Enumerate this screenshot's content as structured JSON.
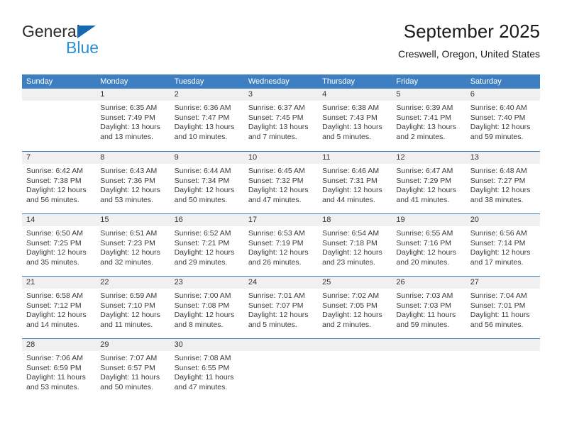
{
  "brand": {
    "line1": "General",
    "line2": "Blue",
    "triangle_color": "#1668b3",
    "line2_color": "#2a8fd4"
  },
  "header": {
    "title": "September 2025",
    "subtitle": "Creswell, Oregon, United States"
  },
  "colors": {
    "header_row": "#3d7fc1",
    "day_band": "#f0f0f0",
    "row_divider": "#3d7fc1",
    "text": "#3a3a3a"
  },
  "weekdays": [
    "Sunday",
    "Monday",
    "Tuesday",
    "Wednesday",
    "Thursday",
    "Friday",
    "Saturday"
  ],
  "weeks": [
    [
      {
        "day": "",
        "sunrise": "",
        "sunset": "",
        "daylight_a": "",
        "daylight_b": "",
        "empty": true
      },
      {
        "day": "1",
        "sunrise": "Sunrise: 6:35 AM",
        "sunset": "Sunset: 7:49 PM",
        "daylight_a": "Daylight: 13 hours",
        "daylight_b": "and 13 minutes."
      },
      {
        "day": "2",
        "sunrise": "Sunrise: 6:36 AM",
        "sunset": "Sunset: 7:47 PM",
        "daylight_a": "Daylight: 13 hours",
        "daylight_b": "and 10 minutes."
      },
      {
        "day": "3",
        "sunrise": "Sunrise: 6:37 AM",
        "sunset": "Sunset: 7:45 PM",
        "daylight_a": "Daylight: 13 hours",
        "daylight_b": "and 7 minutes."
      },
      {
        "day": "4",
        "sunrise": "Sunrise: 6:38 AM",
        "sunset": "Sunset: 7:43 PM",
        "daylight_a": "Daylight: 13 hours",
        "daylight_b": "and 5 minutes."
      },
      {
        "day": "5",
        "sunrise": "Sunrise: 6:39 AM",
        "sunset": "Sunset: 7:41 PM",
        "daylight_a": "Daylight: 13 hours",
        "daylight_b": "and 2 minutes."
      },
      {
        "day": "6",
        "sunrise": "Sunrise: 6:40 AM",
        "sunset": "Sunset: 7:40 PM",
        "daylight_a": "Daylight: 12 hours",
        "daylight_b": "and 59 minutes."
      }
    ],
    [
      {
        "day": "7",
        "sunrise": "Sunrise: 6:42 AM",
        "sunset": "Sunset: 7:38 PM",
        "daylight_a": "Daylight: 12 hours",
        "daylight_b": "and 56 minutes."
      },
      {
        "day": "8",
        "sunrise": "Sunrise: 6:43 AM",
        "sunset": "Sunset: 7:36 PM",
        "daylight_a": "Daylight: 12 hours",
        "daylight_b": "and 53 minutes."
      },
      {
        "day": "9",
        "sunrise": "Sunrise: 6:44 AM",
        "sunset": "Sunset: 7:34 PM",
        "daylight_a": "Daylight: 12 hours",
        "daylight_b": "and 50 minutes."
      },
      {
        "day": "10",
        "sunrise": "Sunrise: 6:45 AM",
        "sunset": "Sunset: 7:32 PM",
        "daylight_a": "Daylight: 12 hours",
        "daylight_b": "and 47 minutes."
      },
      {
        "day": "11",
        "sunrise": "Sunrise: 6:46 AM",
        "sunset": "Sunset: 7:31 PM",
        "daylight_a": "Daylight: 12 hours",
        "daylight_b": "and 44 minutes."
      },
      {
        "day": "12",
        "sunrise": "Sunrise: 6:47 AM",
        "sunset": "Sunset: 7:29 PM",
        "daylight_a": "Daylight: 12 hours",
        "daylight_b": "and 41 minutes."
      },
      {
        "day": "13",
        "sunrise": "Sunrise: 6:48 AM",
        "sunset": "Sunset: 7:27 PM",
        "daylight_a": "Daylight: 12 hours",
        "daylight_b": "and 38 minutes."
      }
    ],
    [
      {
        "day": "14",
        "sunrise": "Sunrise: 6:50 AM",
        "sunset": "Sunset: 7:25 PM",
        "daylight_a": "Daylight: 12 hours",
        "daylight_b": "and 35 minutes."
      },
      {
        "day": "15",
        "sunrise": "Sunrise: 6:51 AM",
        "sunset": "Sunset: 7:23 PM",
        "daylight_a": "Daylight: 12 hours",
        "daylight_b": "and 32 minutes."
      },
      {
        "day": "16",
        "sunrise": "Sunrise: 6:52 AM",
        "sunset": "Sunset: 7:21 PM",
        "daylight_a": "Daylight: 12 hours",
        "daylight_b": "and 29 minutes."
      },
      {
        "day": "17",
        "sunrise": "Sunrise: 6:53 AM",
        "sunset": "Sunset: 7:19 PM",
        "daylight_a": "Daylight: 12 hours",
        "daylight_b": "and 26 minutes."
      },
      {
        "day": "18",
        "sunrise": "Sunrise: 6:54 AM",
        "sunset": "Sunset: 7:18 PM",
        "daylight_a": "Daylight: 12 hours",
        "daylight_b": "and 23 minutes."
      },
      {
        "day": "19",
        "sunrise": "Sunrise: 6:55 AM",
        "sunset": "Sunset: 7:16 PM",
        "daylight_a": "Daylight: 12 hours",
        "daylight_b": "and 20 minutes."
      },
      {
        "day": "20",
        "sunrise": "Sunrise: 6:56 AM",
        "sunset": "Sunset: 7:14 PM",
        "daylight_a": "Daylight: 12 hours",
        "daylight_b": "and 17 minutes."
      }
    ],
    [
      {
        "day": "21",
        "sunrise": "Sunrise: 6:58 AM",
        "sunset": "Sunset: 7:12 PM",
        "daylight_a": "Daylight: 12 hours",
        "daylight_b": "and 14 minutes."
      },
      {
        "day": "22",
        "sunrise": "Sunrise: 6:59 AM",
        "sunset": "Sunset: 7:10 PM",
        "daylight_a": "Daylight: 12 hours",
        "daylight_b": "and 11 minutes."
      },
      {
        "day": "23",
        "sunrise": "Sunrise: 7:00 AM",
        "sunset": "Sunset: 7:08 PM",
        "daylight_a": "Daylight: 12 hours",
        "daylight_b": "and 8 minutes."
      },
      {
        "day": "24",
        "sunrise": "Sunrise: 7:01 AM",
        "sunset": "Sunset: 7:07 PM",
        "daylight_a": "Daylight: 12 hours",
        "daylight_b": "and 5 minutes."
      },
      {
        "day": "25",
        "sunrise": "Sunrise: 7:02 AM",
        "sunset": "Sunset: 7:05 PM",
        "daylight_a": "Daylight: 12 hours",
        "daylight_b": "and 2 minutes."
      },
      {
        "day": "26",
        "sunrise": "Sunrise: 7:03 AM",
        "sunset": "Sunset: 7:03 PM",
        "daylight_a": "Daylight: 11 hours",
        "daylight_b": "and 59 minutes."
      },
      {
        "day": "27",
        "sunrise": "Sunrise: 7:04 AM",
        "sunset": "Sunset: 7:01 PM",
        "daylight_a": "Daylight: 11 hours",
        "daylight_b": "and 56 minutes."
      }
    ],
    [
      {
        "day": "28",
        "sunrise": "Sunrise: 7:06 AM",
        "sunset": "Sunset: 6:59 PM",
        "daylight_a": "Daylight: 11 hours",
        "daylight_b": "and 53 minutes."
      },
      {
        "day": "29",
        "sunrise": "Sunrise: 7:07 AM",
        "sunset": "Sunset: 6:57 PM",
        "daylight_a": "Daylight: 11 hours",
        "daylight_b": "and 50 minutes."
      },
      {
        "day": "30",
        "sunrise": "Sunrise: 7:08 AM",
        "sunset": "Sunset: 6:55 PM",
        "daylight_a": "Daylight: 11 hours",
        "daylight_b": "and 47 minutes."
      },
      {
        "day": "",
        "sunrise": "",
        "sunset": "",
        "daylight_a": "",
        "daylight_b": "",
        "empty": true
      },
      {
        "day": "",
        "sunrise": "",
        "sunset": "",
        "daylight_a": "",
        "daylight_b": "",
        "empty": true
      },
      {
        "day": "",
        "sunrise": "",
        "sunset": "",
        "daylight_a": "",
        "daylight_b": "",
        "empty": true
      },
      {
        "day": "",
        "sunrise": "",
        "sunset": "",
        "daylight_a": "",
        "daylight_b": "",
        "empty": true
      }
    ]
  ]
}
